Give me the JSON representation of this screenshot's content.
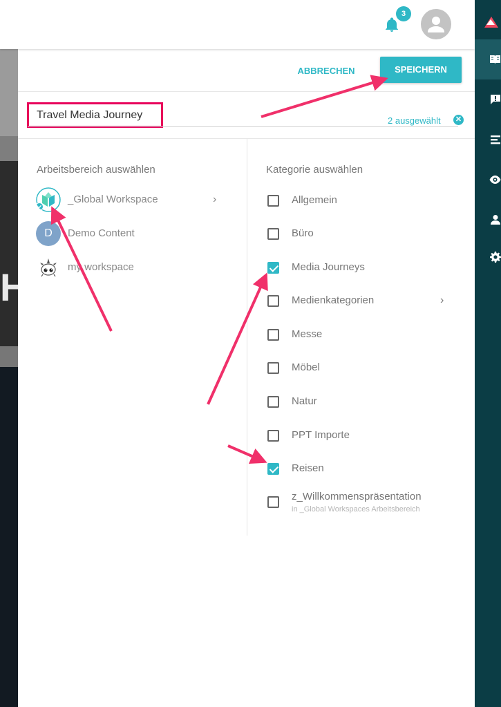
{
  "header": {
    "notification_count": "3"
  },
  "actions": {
    "cancel_label": "ABBRECHEN",
    "save_label": "SPEICHERN"
  },
  "journey": {
    "name_value": "Travel Media Journey"
  },
  "workspaces": {
    "title": "Arbeitsbereich auswählen",
    "items": [
      {
        "label": "_Global Workspace",
        "icon": "global-workspace-logo",
        "selected": true,
        "has_submenu": true
      },
      {
        "label": "Demo Content",
        "icon": "letter-avatar",
        "avatar_letter": "D",
        "selected": false
      },
      {
        "label": "my workspace",
        "icon": "unicorn-mascot",
        "selected": false
      }
    ]
  },
  "categories": {
    "title": "Kategorie auswählen",
    "selected_count": "2 ausgewählt",
    "items": [
      {
        "label": "Allgemein",
        "checked": false
      },
      {
        "label": "Büro",
        "checked": false
      },
      {
        "label": "Media Journeys",
        "checked": true
      },
      {
        "label": "Medienkategorien",
        "checked": false,
        "has_submenu": true
      },
      {
        "label": "Messe",
        "checked": false
      },
      {
        "label": "Möbel",
        "checked": false
      },
      {
        "label": "Natur",
        "checked": false
      },
      {
        "label": "PPT Importe",
        "checked": false
      },
      {
        "label": "Reisen",
        "checked": true
      },
      {
        "label": "z_Willkommenspräsentation",
        "checked": false,
        "sublabel": "in _Global Workspaces Arbeitsbereich"
      }
    ]
  },
  "sidebar": {
    "icons": [
      "book-open-icon",
      "feedback-icon",
      "list-icon",
      "eye-icon",
      "person-icon",
      "gear-icon"
    ],
    "active_icon": "book-open-icon"
  },
  "colors": {
    "accent": "#2fb8c6",
    "annotation": "#e8005a",
    "sidebar": "#0b3d45"
  }
}
